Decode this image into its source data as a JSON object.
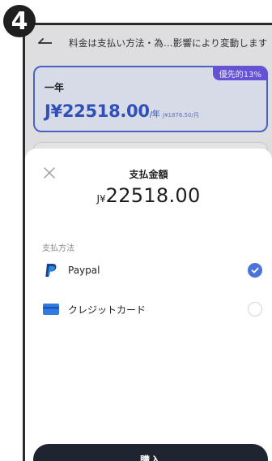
{
  "step": {
    "number": "4"
  },
  "header": {
    "notice": "料金は支払い方法・為…影響により変動します"
  },
  "plan": {
    "name": "一年",
    "price": "J¥22518.00",
    "period": "/年",
    "monthly": "J¥1876.50/月",
    "badge": "優先的13%"
  },
  "sheet": {
    "title": "支払金額",
    "currency": "J¥",
    "amount": "22518.00",
    "section_label": "支払方法",
    "methods": [
      {
        "label": "Paypal",
        "icon": "paypal-icon",
        "selected": true
      },
      {
        "label": "クレジットカード",
        "icon": "credit-card-icon",
        "selected": false
      }
    ],
    "buy_label": "購入"
  },
  "colors": {
    "accent": "#4a74d9",
    "plan_price": "#3557c9",
    "badge": "#6f5ae8",
    "button": "#1f2530"
  }
}
